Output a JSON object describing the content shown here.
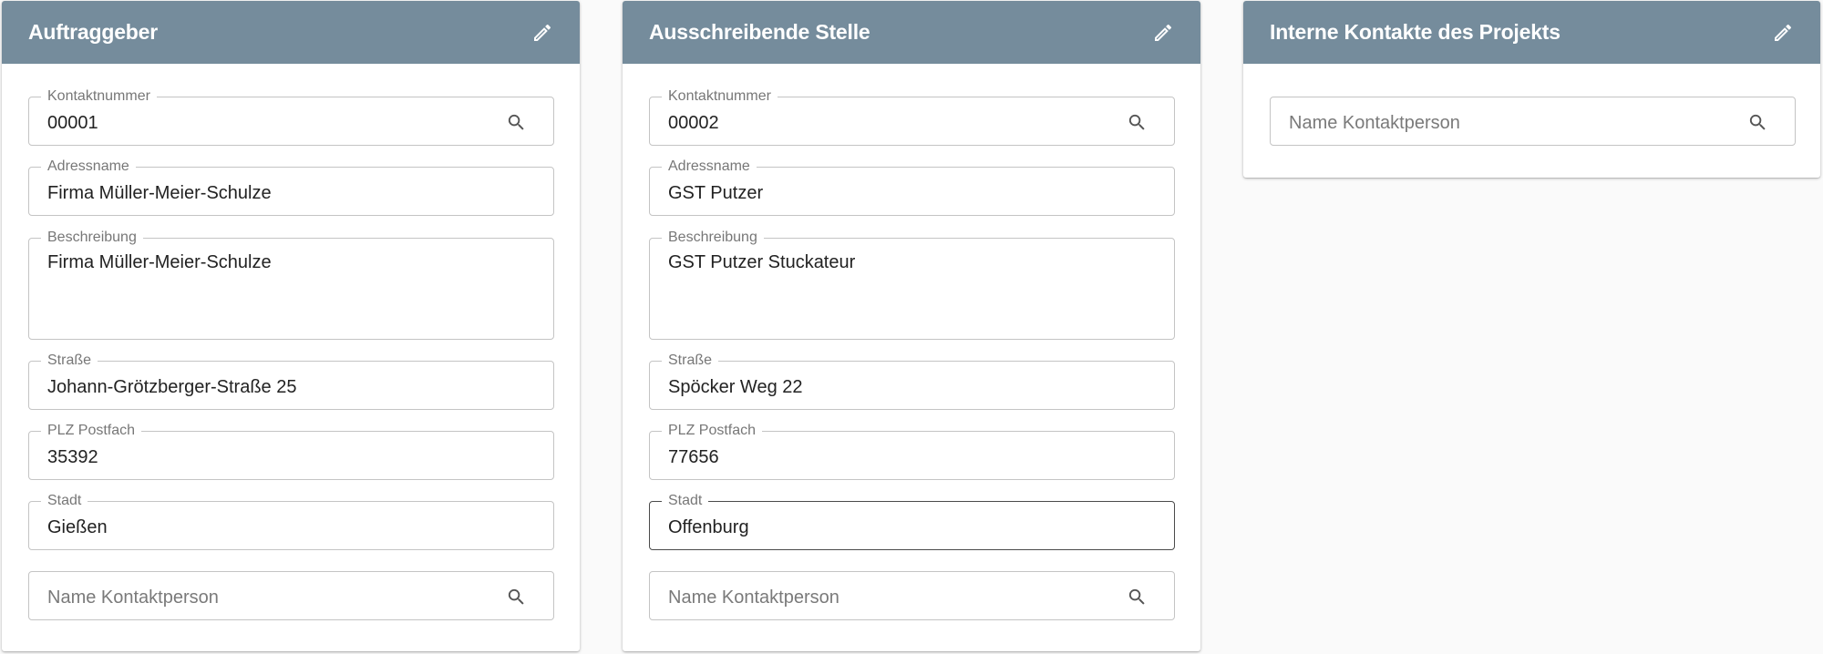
{
  "cards": [
    {
      "title": "Auftraggeber",
      "contact_number": {
        "label": "Kontaktnummer",
        "value": "00001"
      },
      "address_name": {
        "label": "Adressname",
        "value": "Firma Müller-Meier-Schulze"
      },
      "description": {
        "label": "Beschreibung",
        "value": "Firma Müller-Meier-Schulze"
      },
      "street": {
        "label": "Straße",
        "value": "Johann-Grötzberger-Straße 25"
      },
      "postal_code": {
        "label": "PLZ Postfach",
        "value": "35392"
      },
      "city": {
        "label": "Stadt",
        "value": "Gießen"
      },
      "contact_person": {
        "placeholder": "Name Kontaktperson"
      }
    },
    {
      "title": "Ausschreibende Stelle",
      "contact_number": {
        "label": "Kontaktnummer",
        "value": "00002"
      },
      "address_name": {
        "label": "Adressname",
        "value": "GST Putzer"
      },
      "description": {
        "label": "Beschreibung",
        "value": "GST Putzer Stuckateur"
      },
      "street": {
        "label": "Straße",
        "value": "Spöcker Weg 22"
      },
      "postal_code": {
        "label": "PLZ Postfach",
        "value": "77656"
      },
      "city": {
        "label": "Stadt",
        "value": "Offenburg"
      },
      "contact_person": {
        "placeholder": "Name Kontaktperson"
      }
    },
    {
      "title": "Interne Kontakte des Projekts",
      "contact_person": {
        "placeholder": "Name Kontaktperson"
      }
    }
  ],
  "colors": {
    "header_bg": "#758c9c",
    "header_text": "#ffffff",
    "page_bg": "#fafafa",
    "field_border": "#c4c4c4",
    "field_border_active": "#4a4a4a"
  },
  "icons": {
    "edit": "pencil-icon",
    "search": "search-icon"
  }
}
